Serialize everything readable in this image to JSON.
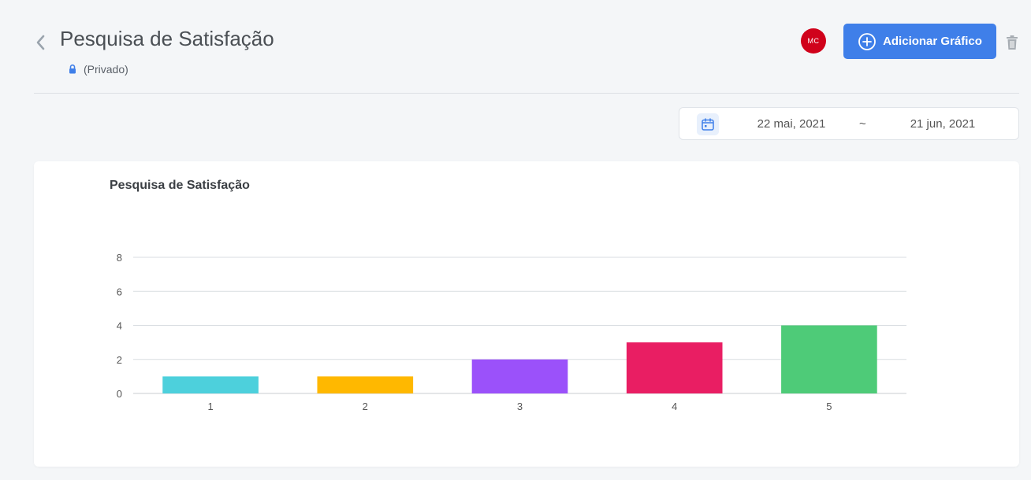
{
  "header": {
    "title": "Pesquisa de Satisfação",
    "privacy_label": "(Privado)",
    "avatar_initials": "MC",
    "add_chart_label": "Adicionar Gráfico"
  },
  "date_range": {
    "start": "22 mai, 2021",
    "separator": "~",
    "end": "21 jun, 2021"
  },
  "colors": {
    "accent": "#3f7fe9",
    "avatar": "#d0021b"
  },
  "icons": [
    "chevron-left-icon",
    "lock-icon",
    "plus-circle-icon",
    "trash-icon",
    "calendar-icon"
  ],
  "chart_data": {
    "type": "bar",
    "title": "Pesquisa de Satisfação",
    "categories": [
      "1",
      "2",
      "3",
      "4",
      "5"
    ],
    "values": [
      1,
      1,
      2,
      3,
      4
    ],
    "colors": [
      "#4dd0dc",
      "#ffb800",
      "#9b51fa",
      "#e91e63",
      "#4ecb78"
    ],
    "ylim": [
      0,
      8
    ],
    "yticks": [
      0,
      2,
      4,
      6,
      8
    ],
    "xlabel": "",
    "ylabel": "",
    "grid": true
  }
}
